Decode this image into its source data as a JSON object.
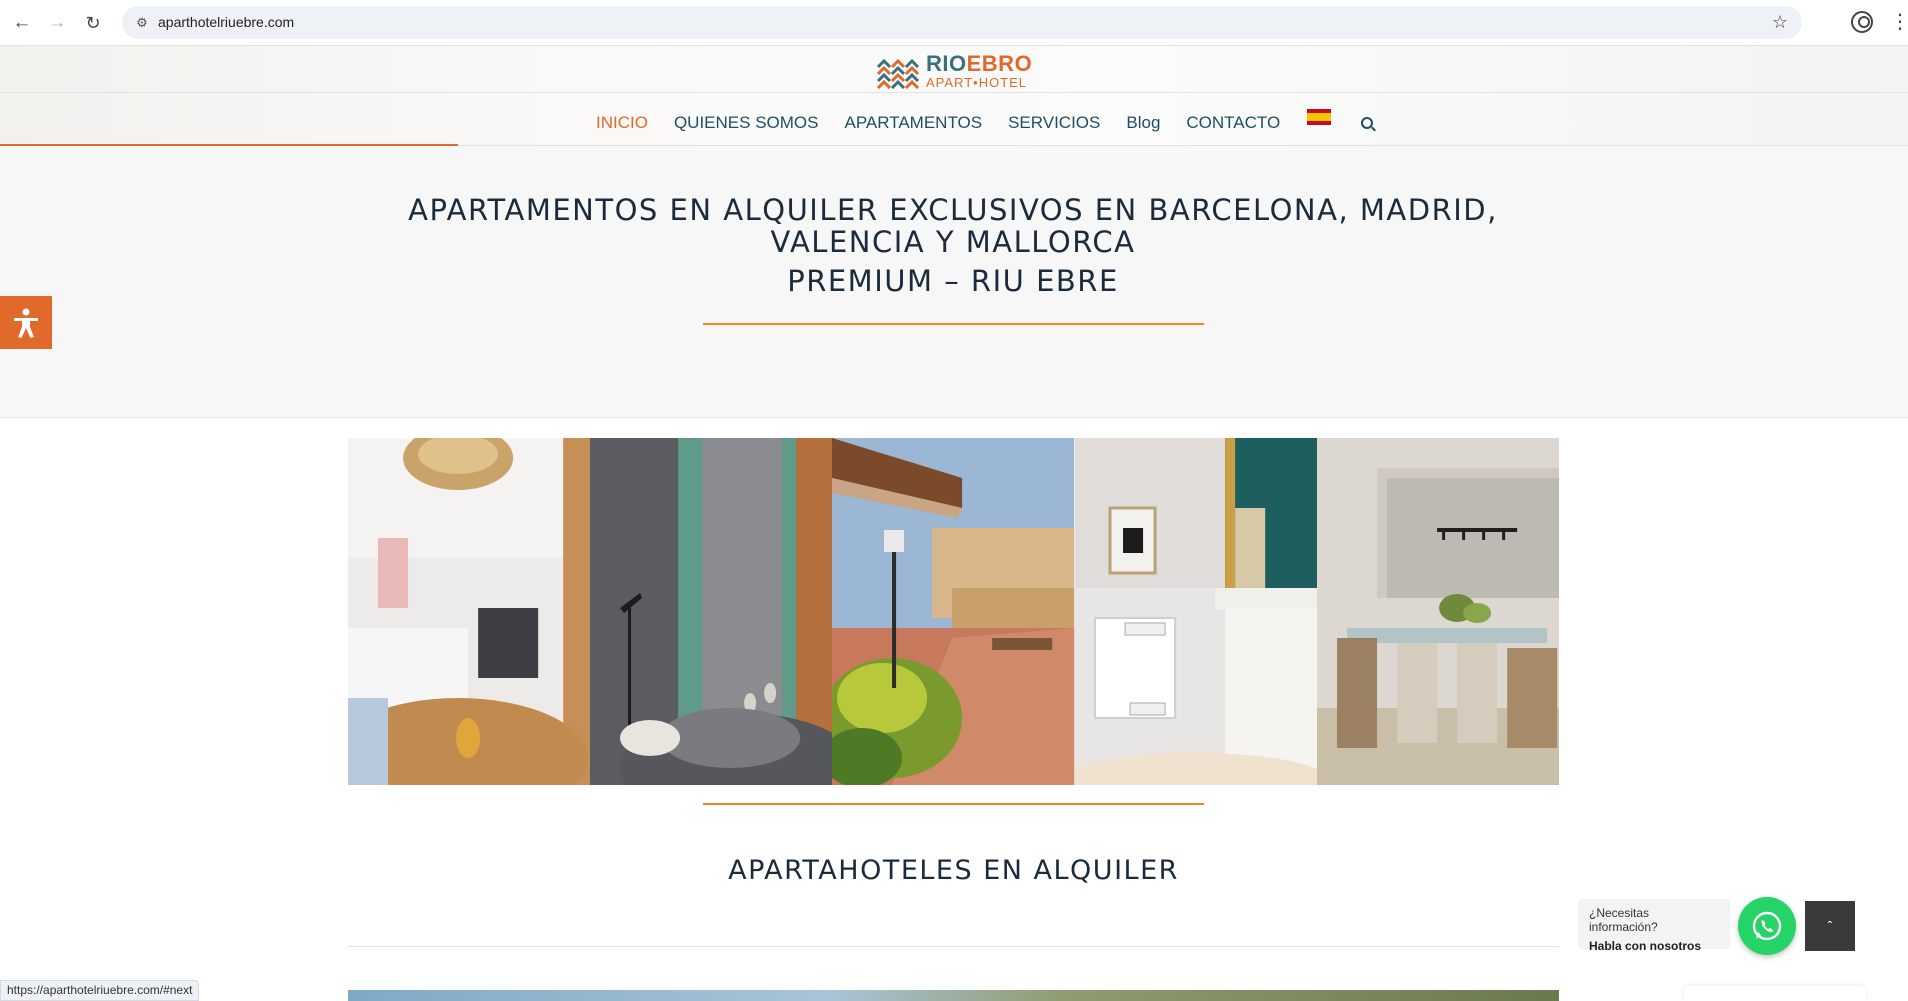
{
  "browser": {
    "url": "aparthotelriuebre.com",
    "back_icon": "arrow-left-icon",
    "forward_icon": "arrow-right-icon",
    "reload_icon": "reload-icon",
    "status_url": "https://aparthotelriuebre.com/#next"
  },
  "logo": {
    "line1_a": "RIO",
    "line1_b": "EBRO",
    "line2": "APART•HOTEL"
  },
  "nav": {
    "items": [
      {
        "label": "INICIO",
        "active": true
      },
      {
        "label": "QUIENES SOMOS",
        "active": false
      },
      {
        "label": "APARTAMENTOS",
        "active": false
      },
      {
        "label": "SERVICIOS",
        "active": false
      },
      {
        "label": "Blog",
        "active": false
      },
      {
        "label": "CONTACTO",
        "active": false
      }
    ],
    "language_flag": "spain-flag-icon"
  },
  "scroll_progress": 0.24,
  "hero": {
    "title": "APARTAMENTOS EN ALQUILER EXCLUSIVOS EN BARCELONA, MADRID, VALENCIA Y MALLORCA",
    "subtitle": "PREMIUM – RIU EBRE"
  },
  "gallery": {
    "photos": [
      {
        "name": "living-room-photo"
      },
      {
        "name": "green-door-photo"
      },
      {
        "name": "terrace-photo"
      },
      {
        "name": "fireplace-photo"
      },
      {
        "name": "dining-room-photo"
      }
    ]
  },
  "section": {
    "title": "APARTAHOTELES EN ALQUILER"
  },
  "whatsapp": {
    "question": "¿Necesitas información?",
    "cta": "Habla con nosotros"
  },
  "colors": {
    "accent": "#e1692a",
    "nav_text": "#1e4e63",
    "heading": "#1b2a3d",
    "whatsapp": "#25d366"
  }
}
